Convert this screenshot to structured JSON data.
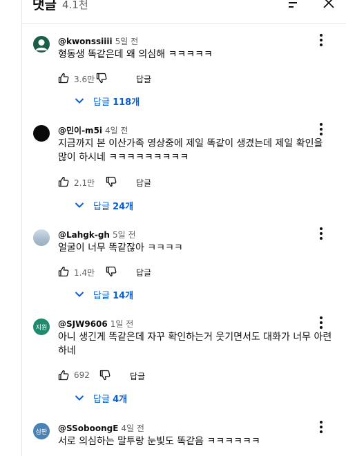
{
  "header": {
    "title": "댓글",
    "count": "4.1천"
  },
  "reply_label": "답글",
  "comments": [
    {
      "author": "@kwonssiiii",
      "time": "5일 전",
      "text": "형동생 똑같은데 왜 의심해 ㅋㅋㅋㅋㅋ",
      "likes": "3.6만",
      "replies_label": "답글",
      "replies_count": "118개",
      "avatar_color": "#1b5e46"
    },
    {
      "author": "@민이-m5i",
      "time": "4일 전",
      "text": "지금까지 본 이산가족 영상중에 제일 똑같이 생겼는데 제일 확인을 많이 하시네 ㅋㅋㅋㅋㅋㅋㅋㅋㅋ",
      "likes": "2.1만",
      "replies_label": "답글",
      "replies_count": "24개",
      "avatar_color": "#0a0a0a"
    },
    {
      "author": "@Lahgk-gh",
      "time": "5일 전",
      "text": "얼굴이 너무 똑같잖아 ㅋㅋㅋㅋ",
      "likes": "1.4만",
      "replies_label": "답글",
      "replies_count": "14개",
      "avatar_color": "#b7c7d6"
    },
    {
      "author": "@SJW9606",
      "time": "1일 전",
      "text": "아니 생긴게 똑같은데 자꾸 확인하는거 웃기면서도 대화가 너무 아련하네",
      "likes": "692",
      "replies_label": "답글",
      "replies_count": "4개",
      "avatar_text": "지원",
      "avatar_color": "#1e8a6e"
    },
    {
      "author": "@SSoboongE",
      "time": "4일 전",
      "text": "서로 의심하는 말투랑 눈빛도 똑같음 ㅋㅋㅋㅋㅋㅋ",
      "avatar_text": "삼판",
      "avatar_color": "#4a82b6"
    }
  ],
  "colors": {
    "link": "#065fd4",
    "secondary": "#606060",
    "divider": "#e5e5e5"
  },
  "icons": [
    "sort-icon",
    "close-icon",
    "more-vert-icon",
    "thumb-up-icon",
    "thumb-down-icon",
    "chevron-down-icon"
  ]
}
